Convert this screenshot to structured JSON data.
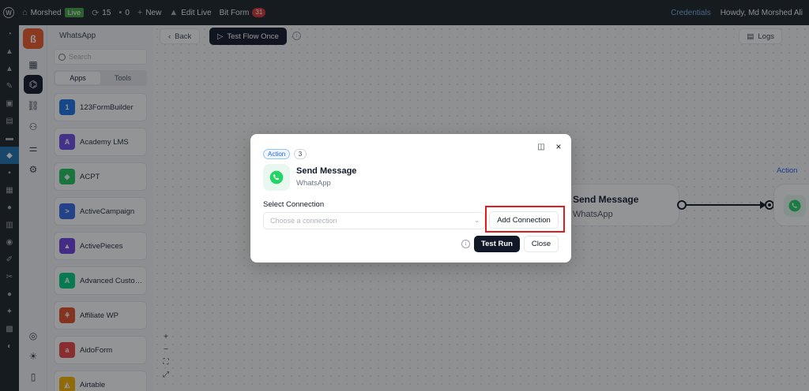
{
  "admin_bar": {
    "site_name": "Morshed",
    "live_badge": "Live",
    "updates_count": "15",
    "comments_count": "0",
    "new_label": "New",
    "edit_live_label": "Edit Live",
    "bit_form_label": "Bit Form",
    "bit_form_badge": "31",
    "credentials_label": "Credentials",
    "howdy_label": "Howdy, Md Morshed Ali"
  },
  "apps_panel": {
    "title": "WhatsApp",
    "search_placeholder": "Search",
    "tabs": [
      {
        "label": "Apps",
        "active": true
      },
      {
        "label": "Tools",
        "active": false
      }
    ],
    "apps": [
      {
        "name": "123FormBuilder",
        "icon": "123formbuilder-icon",
        "color": "#1a73e8"
      },
      {
        "name": "Academy LMS",
        "icon": "academy-lms-icon",
        "color": "#6d4ee6"
      },
      {
        "name": "ACPT",
        "icon": "acpt-icon",
        "color": "#22c55e"
      },
      {
        "name": "ActiveCampaign",
        "icon": "activecampaign-icon",
        "color": "#356ae6"
      },
      {
        "name": "ActivePieces",
        "icon": "activepieces-icon",
        "color": "#6e41e2"
      },
      {
        "name": "Advanced Custom Fields",
        "icon": "acf-icon",
        "color": "#00d084"
      },
      {
        "name": "Affiliate WP",
        "icon": "affiliate-wp-icon",
        "color": "#e34f26"
      },
      {
        "name": "AidoForm",
        "icon": "aidoform-icon",
        "color": "#ef4444"
      },
      {
        "name": "Airtable",
        "icon": "airtable-icon",
        "color": "#fcb400"
      }
    ]
  },
  "toolbar": {
    "back_label": "Back",
    "test_flow_label": "Test Flow Once",
    "logs_label": "Logs"
  },
  "canvas": {
    "node_number": "2",
    "node_title": "Send Message",
    "node_subtitle": "WhatsApp",
    "next_node_label": "Action",
    "zoom_in": "+",
    "zoom_out": "−"
  },
  "modal": {
    "type_badge": "Action",
    "step_number": "3",
    "title": "Send Message",
    "subtitle": "WhatsApp",
    "select_label": "Select Connection",
    "select_placeholder": "Choose a connection",
    "add_connection_label": "Add Connection",
    "test_run_label": "Test Run",
    "close_label": "Close"
  },
  "colors": {
    "accent_dark": "#111827",
    "brand_orange": "#f05a28",
    "whatsapp_green": "#25d366",
    "highlight_red": "#e11d1d",
    "action_blue": "#2563eb"
  }
}
